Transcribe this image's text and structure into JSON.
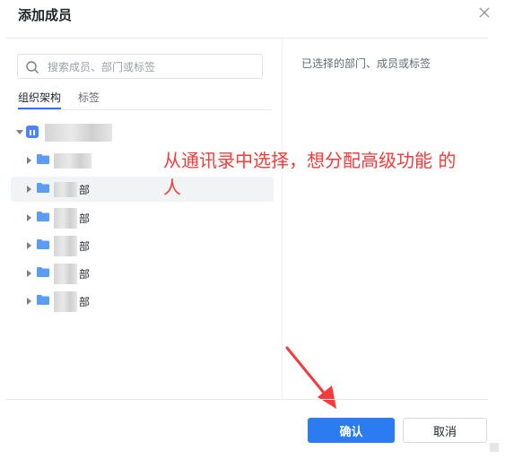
{
  "dialog": {
    "title": "添加成员",
    "close_icon": "close-icon"
  },
  "left_panel": {
    "search_placeholder": "搜索成员、部门或标签",
    "tabs": [
      {
        "label": "组织架构",
        "active": true
      },
      {
        "label": "标签",
        "active": false
      }
    ],
    "tree": {
      "root_icon": "org-icon",
      "children": [
        {
          "suffix": ""
        },
        {
          "suffix": "部",
          "highlighted": true
        },
        {
          "suffix": "部"
        },
        {
          "suffix": "部"
        },
        {
          "suffix": "部"
        },
        {
          "suffix": "部"
        }
      ]
    }
  },
  "right_panel": {
    "title": "已选择的部门、成员或标签"
  },
  "annotation": {
    "text": "从通讯录中选择，想分配高级功能 的人",
    "color": "#f53b3b"
  },
  "footer": {
    "confirm_label": "确认",
    "cancel_label": "取消"
  },
  "colors": {
    "primary": "#2a7cf0",
    "folder": "#5b9df6"
  }
}
